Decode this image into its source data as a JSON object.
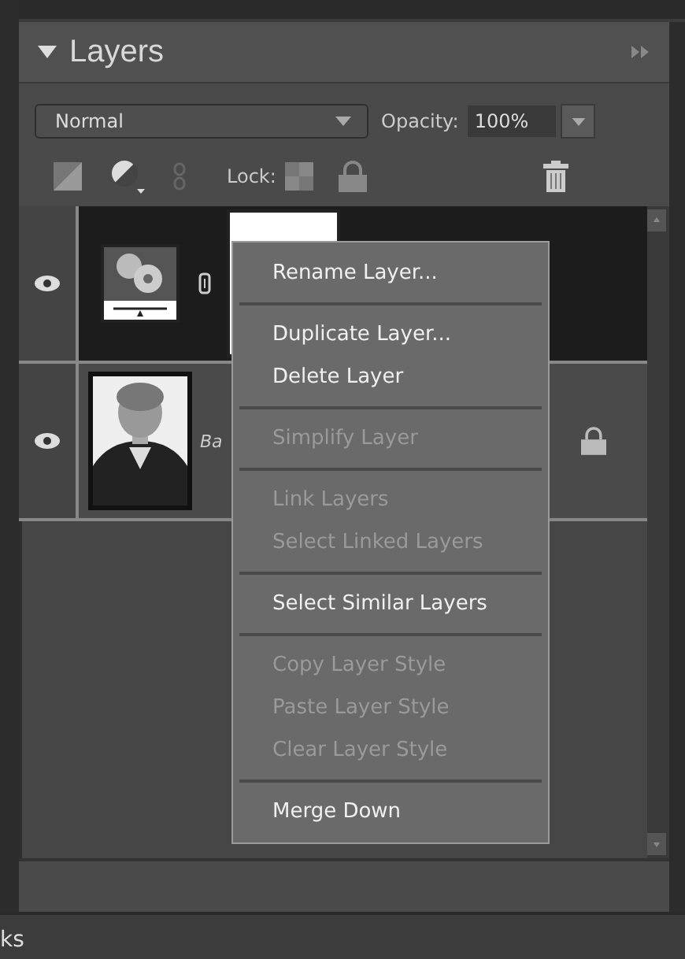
{
  "panel": {
    "title": "Layers",
    "blend_mode": "Normal",
    "opacity_label": "Opacity:",
    "opacity_value": "100%",
    "lock_label": "Lock:"
  },
  "layers": [
    {
      "selected": true,
      "visible": true,
      "locked": false,
      "kind": "adjustment"
    },
    {
      "name": "Ba",
      "selected": false,
      "visible": true,
      "locked": true
    }
  ],
  "context_menu": [
    {
      "kind": "item",
      "label": "Rename Layer...",
      "disabled": false
    },
    {
      "kind": "separator"
    },
    {
      "kind": "item",
      "label": "Duplicate Layer...",
      "disabled": false
    },
    {
      "kind": "item",
      "label": "Delete Layer",
      "disabled": false
    },
    {
      "kind": "separator"
    },
    {
      "kind": "item",
      "label": "Simplify Layer",
      "disabled": true
    },
    {
      "kind": "separator"
    },
    {
      "kind": "item",
      "label": "Link Layers",
      "disabled": true
    },
    {
      "kind": "item",
      "label": "Select Linked Layers",
      "disabled": true
    },
    {
      "kind": "separator"
    },
    {
      "kind": "item",
      "label": "Select Similar Layers",
      "disabled": false
    },
    {
      "kind": "separator"
    },
    {
      "kind": "item",
      "label": "Copy Layer Style",
      "disabled": true
    },
    {
      "kind": "item",
      "label": "Paste Layer Style",
      "disabled": true
    },
    {
      "kind": "item",
      "label": "Clear Layer Style",
      "disabled": true
    },
    {
      "kind": "separator"
    },
    {
      "kind": "item",
      "label": "Merge Down",
      "disabled": false
    }
  ],
  "bottom_tab": {
    "label": "ks"
  }
}
